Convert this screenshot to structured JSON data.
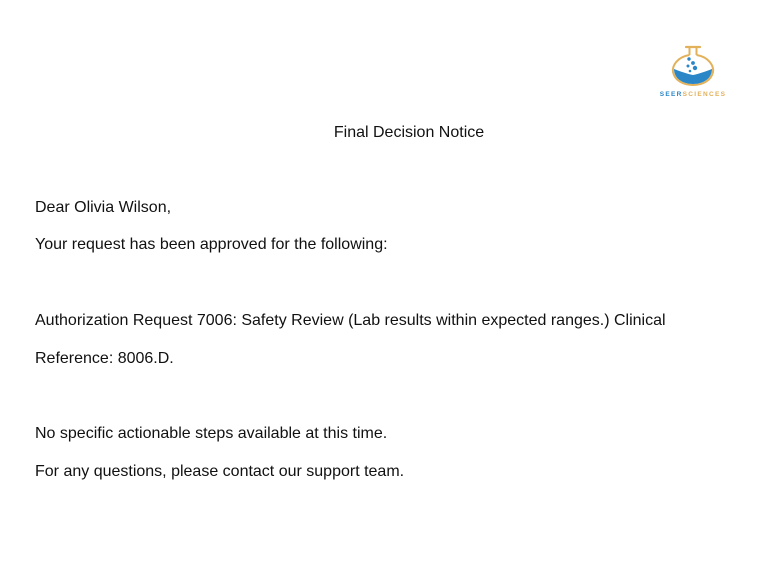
{
  "logo": {
    "icon": "flask-icon",
    "brand_part1": "SEER",
    "brand_part2": "SCIENCES",
    "colors": {
      "blue": "#2a86c6",
      "gold": "#e2b15a"
    }
  },
  "notice": {
    "title": "Final Decision Notice",
    "greeting": "Dear Olivia Wilson,",
    "intro": "Your request has been approved for the following:",
    "authorization_line1": "Authorization Request 7006: Safety Review (Lab results within expected ranges.) Clinical",
    "authorization_line2": "Reference: 8006.D.",
    "steps": "No specific actionable steps available at this time.",
    "contact": "For any questions, please contact our support team."
  }
}
